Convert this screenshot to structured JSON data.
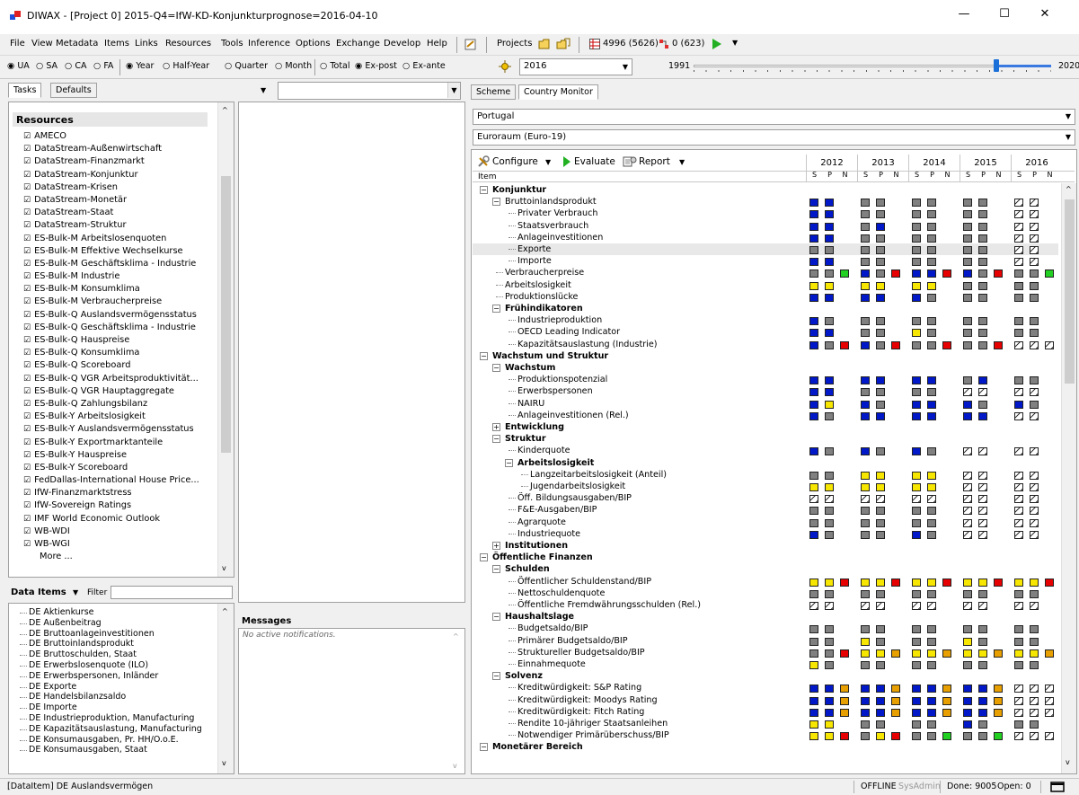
{
  "window": {
    "title": "DIWAX - [Project 0] 2015-Q4=IfW-KD-Konjunkturprognose=2016-04-10",
    "minimize": "—",
    "maximize": "☐",
    "close": "✕"
  },
  "menu": {
    "items": [
      "File",
      "View",
      "Metadata",
      "Items",
      "Links",
      "Resources",
      "Tools",
      "Inference",
      "Options",
      "Exchange",
      "Develop",
      "Help"
    ],
    "projects_label": "Projects",
    "counts_a": "4996 (5626)",
    "counts_b": "0 (623)"
  },
  "options": {
    "scope": [
      "UA",
      "SA",
      "CA",
      "FA"
    ],
    "scope_selected": "UA",
    "period": [
      "Year",
      "Half-Year",
      "Quarter",
      "Month"
    ],
    "period_selected": "Year",
    "total": "Total",
    "expost": "Ex-post",
    "exante": "Ex-ante",
    "expost_selected": true,
    "year_value": "2016",
    "range_start": "1991",
    "range_end": "2020"
  },
  "left": {
    "tabs": [
      "Tasks",
      "Defaults"
    ],
    "resources_header": "Resources",
    "resources": [
      "AMECO",
      "DataStream-Außenwirtschaft",
      "DataStream-Finanzmarkt",
      "DataStream-Konjunktur",
      "DataStream-Krisen",
      "DataStream-Monetär",
      "DataStream-Staat",
      "DataStream-Struktur",
      "ES-Bulk-M Arbeitslosenquoten",
      "ES-Bulk-M Effektive Wechselkurse",
      "ES-Bulk-M Geschäftsklima - Industrie",
      "ES-Bulk-M Industrie",
      "ES-Bulk-M Konsumklima",
      "ES-Bulk-M Verbraucherpreise",
      "ES-Bulk-Q Auslandsvermögensstatus",
      "ES-Bulk-Q Geschäftsklima - Industrie",
      "ES-Bulk-Q Hauspreise",
      "ES-Bulk-Q Konsumklima",
      "ES-Bulk-Q Scoreboard",
      "ES-Bulk-Q VGR Arbeitsproduktivität...",
      "ES-Bulk-Q VGR Hauptaggregate",
      "ES-Bulk-Q Zahlungsbilanz",
      "ES-Bulk-Y Arbeitslosigkeit",
      "ES-Bulk-Y Auslandsvermögensstatus",
      "ES-Bulk-Y Exportmarktanteile",
      "ES-Bulk-Y Hauspreise",
      "ES-Bulk-Y Scoreboard",
      "FedDallas-International House Price...",
      "IfW-Finanzmarktstress",
      "IfW-Sovereign Ratings",
      "IMF World Economic Outlook",
      "WB-WDI",
      "WB-WGI"
    ],
    "more": "More ...",
    "data_items_label": "Data Items",
    "filter_label": "Filter",
    "data_items": [
      "DE Aktienkurse",
      "DE Außenbeitrag",
      "DE Bruttoanlageinvestitionen",
      "DE Bruttoinlandsprodukt",
      "DE Bruttoschulden, Staat",
      "DE Erwerbslosenquote (ILO)",
      "DE Erwerbspersonen, Inländer",
      "DE Exporte",
      "DE Handelsbilanzsaldo",
      "DE Importe",
      "DE Industrieproduktion, Manufacturing",
      "DE Kapazitätsauslastung, Manufacturing",
      "DE Konsumausgaben, Pr. HH/O.o.E.",
      "DE Konsumausgaben, Staat"
    ]
  },
  "middle": {
    "messages_title": "Messages",
    "messages_text": "No active notifications."
  },
  "right": {
    "tabs": [
      "Scheme",
      "Country Monitor"
    ],
    "country": "Portugal",
    "region": "Euroraum (Euro-19)",
    "configure": "Configure",
    "evaluate": "Evaluate",
    "report": "Report",
    "item_header": "Item",
    "years": [
      "2012",
      "2013",
      "2014",
      "2015",
      "2016"
    ],
    "spn": [
      "S",
      "P",
      "N"
    ]
  },
  "tree": [
    {
      "label": "Konjunktur",
      "level": 0,
      "bold": true,
      "pm": "−",
      "ind": []
    },
    {
      "label": "Bruttoinlandsprodukt",
      "level": 1,
      "pm": "−",
      "ind": [
        "bb",
        "gg",
        "gg",
        "gg",
        "hh"
      ]
    },
    {
      "label": "Privater Verbrauch",
      "level": 2,
      "ind": [
        "bb",
        "gg",
        "gg",
        "gg",
        "hh"
      ]
    },
    {
      "label": "Staatsverbrauch",
      "level": 2,
      "ind": [
        "bb",
        "gb",
        "gg",
        "gg",
        "hh"
      ]
    },
    {
      "label": "Anlageinvestitionen",
      "level": 2,
      "ind": [
        "bb",
        "gg",
        "gg",
        "gg",
        "hh"
      ]
    },
    {
      "label": "Exporte",
      "level": 2,
      "hl": true,
      "ind": [
        "gg",
        "gg",
        "gg",
        "gg",
        "hh"
      ]
    },
    {
      "label": "Importe",
      "level": 2,
      "ind": [
        "bb",
        "gg",
        "gg",
        "gg",
        "hh"
      ]
    },
    {
      "label": "Verbraucherpreise",
      "level": 1,
      "ind": [
        "ggG",
        "bgr",
        "bbr",
        "bgr",
        "ggG"
      ]
    },
    {
      "label": "Arbeitslosigkeit",
      "level": 1,
      "ind": [
        "yy",
        "yy",
        "yy",
        "gg",
        "gg"
      ]
    },
    {
      "label": "Produktionslücke",
      "level": 1,
      "ind": [
        "bb",
        "bb",
        "bg",
        "gg",
        "gg"
      ]
    },
    {
      "label": "Frühindikatoren",
      "level": 1,
      "bold": true,
      "pm": "−",
      "ind": []
    },
    {
      "label": "Industrieproduktion",
      "level": 2,
      "ind": [
        "bg",
        "gg",
        "gg",
        "gg",
        "gg"
      ]
    },
    {
      "label": "OECD Leading Indicator",
      "level": 2,
      "ind": [
        "bb",
        "gg",
        "yg",
        "gg",
        "gg"
      ]
    },
    {
      "label": "Kapazitätsauslastung (Industrie)",
      "level": 2,
      "ind": [
        "bgr",
        "bgr",
        "ggr",
        "ggr",
        "hhh"
      ]
    },
    {
      "label": "Wachstum und Struktur",
      "level": 0,
      "bold": true,
      "pm": "−",
      "ind": []
    },
    {
      "label": "Wachstum",
      "level": 1,
      "bold": true,
      "pm": "−",
      "ind": []
    },
    {
      "label": "Produktionspotenzial",
      "level": 2,
      "ind": [
        "bb",
        "bb",
        "bb",
        "gb",
        "gg"
      ]
    },
    {
      "label": "Erwerbspersonen",
      "level": 2,
      "ind": [
        "bb",
        "gg",
        "gg",
        "hh",
        "hh"
      ]
    },
    {
      "label": "NAIRU",
      "level": 2,
      "ind": [
        "by",
        "bg",
        "bb",
        "bg",
        "bg"
      ]
    },
    {
      "label": "Anlageinvestitionen (Rel.)",
      "level": 2,
      "ind": [
        "bg",
        "bb",
        "bb",
        "bb",
        "hh"
      ]
    },
    {
      "label": "Entwicklung",
      "level": 1,
      "bold": true,
      "pm": "+",
      "ind": []
    },
    {
      "label": "Struktur",
      "level": 1,
      "bold": true,
      "pm": "−",
      "ind": []
    },
    {
      "label": "Kinderquote",
      "level": 2,
      "ind": [
        "bg",
        "bg",
        "bg",
        "hh",
        "hh"
      ]
    },
    {
      "label": "Arbeitslosigkeit",
      "level": 2,
      "bold": true,
      "pm": "−",
      "ind": []
    },
    {
      "label": "Langzeitarbeitslosigkeit (Anteil)",
      "level": 3,
      "ind": [
        "gg",
        "yy",
        "yy",
        "hh",
        "hh"
      ]
    },
    {
      "label": "Jugendarbeitslosigkeit",
      "level": 3,
      "ind": [
        "yy",
        "yy",
        "yy",
        "hh",
        "hh"
      ]
    },
    {
      "label": "Öff. Bildungsausgaben/BIP",
      "level": 2,
      "ind": [
        "hh",
        "hh",
        "hh",
        "hh",
        "hh"
      ]
    },
    {
      "label": "F&E-Ausgaben/BIP",
      "level": 2,
      "ind": [
        "gg",
        "gg",
        "gg",
        "hh",
        "hh"
      ]
    },
    {
      "label": "Agrarquote",
      "level": 2,
      "ind": [
        "gg",
        "gg",
        "gg",
        "hh",
        "hh"
      ]
    },
    {
      "label": "Industriequote",
      "level": 2,
      "ind": [
        "bg",
        "gg",
        "bg",
        "hh",
        "hh"
      ]
    },
    {
      "label": "Institutionen",
      "level": 1,
      "bold": true,
      "pm": "+",
      "ind": []
    },
    {
      "label": "Öffentliche Finanzen",
      "level": 0,
      "bold": true,
      "pm": "−",
      "ind": []
    },
    {
      "label": "Schulden",
      "level": 1,
      "bold": true,
      "pm": "−",
      "ind": []
    },
    {
      "label": "Öffentlicher Schuldenstand/BIP",
      "level": 2,
      "ind": [
        "yyr",
        "yyr",
        "yyr",
        "yyr",
        "yyr"
      ]
    },
    {
      "label": "Nettoschuldenquote",
      "level": 2,
      "ind": [
        "gg",
        "gg",
        "gg",
        "gg",
        "gg"
      ]
    },
    {
      "label": "Öffentliche Fremdwährungsschulden (Rel.)",
      "level": 2,
      "ind": [
        "hh",
        "hh",
        "hh",
        "hh",
        "hh"
      ]
    },
    {
      "label": "Haushaltslage",
      "level": 1,
      "bold": true,
      "pm": "−",
      "ind": []
    },
    {
      "label": "Budgetsaldo/BIP",
      "level": 2,
      "ind": [
        "gg",
        "gg",
        "gg",
        "gg",
        "gg"
      ]
    },
    {
      "label": "Primärer Budgetsaldo/BIP",
      "level": 2,
      "ind": [
        "gg",
        "yg",
        "gg",
        "yg",
        "gg"
      ]
    },
    {
      "label": "Struktureller Budgetsaldo/BIP",
      "level": 2,
      "ind": [
        "ggr",
        "yyo",
        "yyo",
        "yyo",
        "yyo"
      ]
    },
    {
      "label": "Einnahmequote",
      "level": 2,
      "ind": [
        "yg",
        "gg",
        "gg",
        "gg",
        "gg"
      ]
    },
    {
      "label": "Solvenz",
      "level": 1,
      "bold": true,
      "pm": "−",
      "ind": []
    },
    {
      "label": "Kreditwürdigkeit: S&P Rating",
      "level": 2,
      "ind": [
        "bbo",
        "bbo",
        "bbo",
        "bbo",
        "hhh"
      ]
    },
    {
      "label": "Kreditwürdigkeit: Moodys Rating",
      "level": 2,
      "ind": [
        "bbo",
        "bbo",
        "bbo",
        "bbo",
        "hhh"
      ]
    },
    {
      "label": "Kreditwürdigkeit: Fitch Rating",
      "level": 2,
      "ind": [
        "bbo",
        "bbo",
        "bbo",
        "bbo",
        "hhh"
      ]
    },
    {
      "label": "Rendite 10-jähriger Staatsanleihen",
      "level": 2,
      "ind": [
        "yy",
        "gg",
        "gg",
        "bg",
        "gg"
      ]
    },
    {
      "label": "Notwendiger Primärüberschuss/BIP",
      "level": 2,
      "ind": [
        "yyr",
        "gyr",
        "ggG",
        "ggG",
        "hhh"
      ]
    },
    {
      "label": "Monetärer Bereich",
      "level": 0,
      "bold": true,
      "pm": "−",
      "ind": []
    }
  ],
  "status": {
    "left": "[DataItem] DE Auslandsvermögen",
    "offline": "OFFLINE",
    "user": "SysAdmin",
    "done": "Done: 9005",
    "open": "Open: 0"
  },
  "colors": {
    "blue": "#0018c8",
    "gray": "#808080",
    "yellow": "#f7e600",
    "red": "#e60000",
    "green": "#22d022",
    "orange": "#e8a000"
  }
}
